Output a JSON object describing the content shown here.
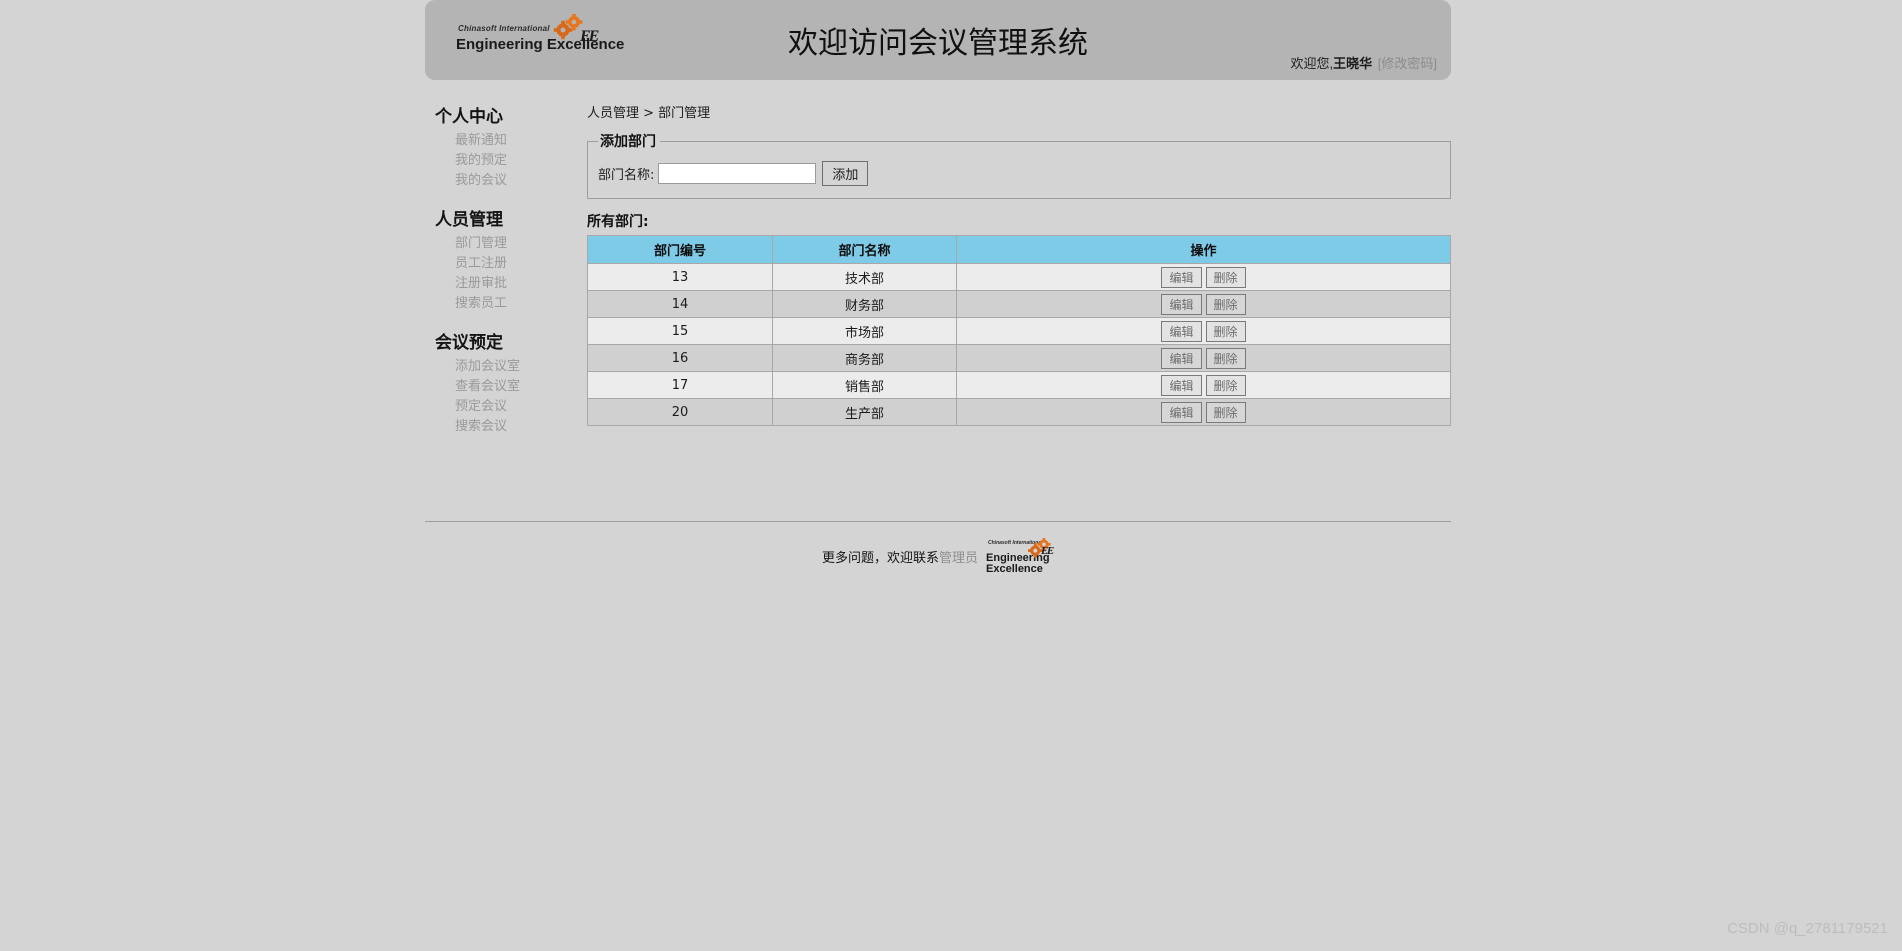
{
  "header": {
    "title": "欢迎访问会议管理系统",
    "greeting_prefix": "欢迎您,",
    "user_name": "王晓华",
    "change_password": "[修改密码]",
    "logo": {
      "line1": "Chinasoft International",
      "line2": "Engineering Excellence",
      "mark": "EE",
      "icon": "gear-logo-icon"
    },
    "colors": {
      "bar": "#b4b4b4",
      "page_bg": "#d4d4d4"
    }
  },
  "sidebar": {
    "groups": [
      {
        "title": "个人中心",
        "items": [
          {
            "label": "最新通知"
          },
          {
            "label": "我的预定"
          },
          {
            "label": "我的会议"
          }
        ]
      },
      {
        "title": "人员管理",
        "items": [
          {
            "label": "部门管理"
          },
          {
            "label": "员工注册"
          },
          {
            "label": "注册审批"
          },
          {
            "label": "搜索员工"
          }
        ]
      },
      {
        "title": "会议预定",
        "items": [
          {
            "label": "添加会议室"
          },
          {
            "label": "查看会议室"
          },
          {
            "label": "预定会议"
          },
          {
            "label": "搜索会议"
          }
        ]
      }
    ]
  },
  "main": {
    "breadcrumb": "人员管理 > 部门管理",
    "add_form": {
      "legend": "添加部门",
      "name_label": "部门名称:",
      "name_value": "",
      "name_placeholder": "",
      "submit_label": "添加"
    },
    "list": {
      "section_title": "所有部门:",
      "columns": [
        "部门编号",
        "部门名称",
        "操作"
      ],
      "header_color": "#7ecbe8",
      "row_actions": {
        "edit": "编辑",
        "delete": "删除"
      },
      "rows": [
        {
          "id": "13",
          "name": "技术部"
        },
        {
          "id": "14",
          "name": "财务部"
        },
        {
          "id": "15",
          "name": "市场部"
        },
        {
          "id": "16",
          "name": "商务部"
        },
        {
          "id": "17",
          "name": "销售部"
        },
        {
          "id": "20",
          "name": "生产部"
        }
      ]
    }
  },
  "footer": {
    "text_prefix": "更多问题，欢迎联系",
    "admin_link": "管理员",
    "logo": {
      "line1": "Chinasoft International",
      "line2a": "Engineering",
      "line2b": "Excellence",
      "mark": "EE",
      "icon": "gear-logo-icon"
    }
  },
  "watermark": "CSDN @q_2781179521"
}
